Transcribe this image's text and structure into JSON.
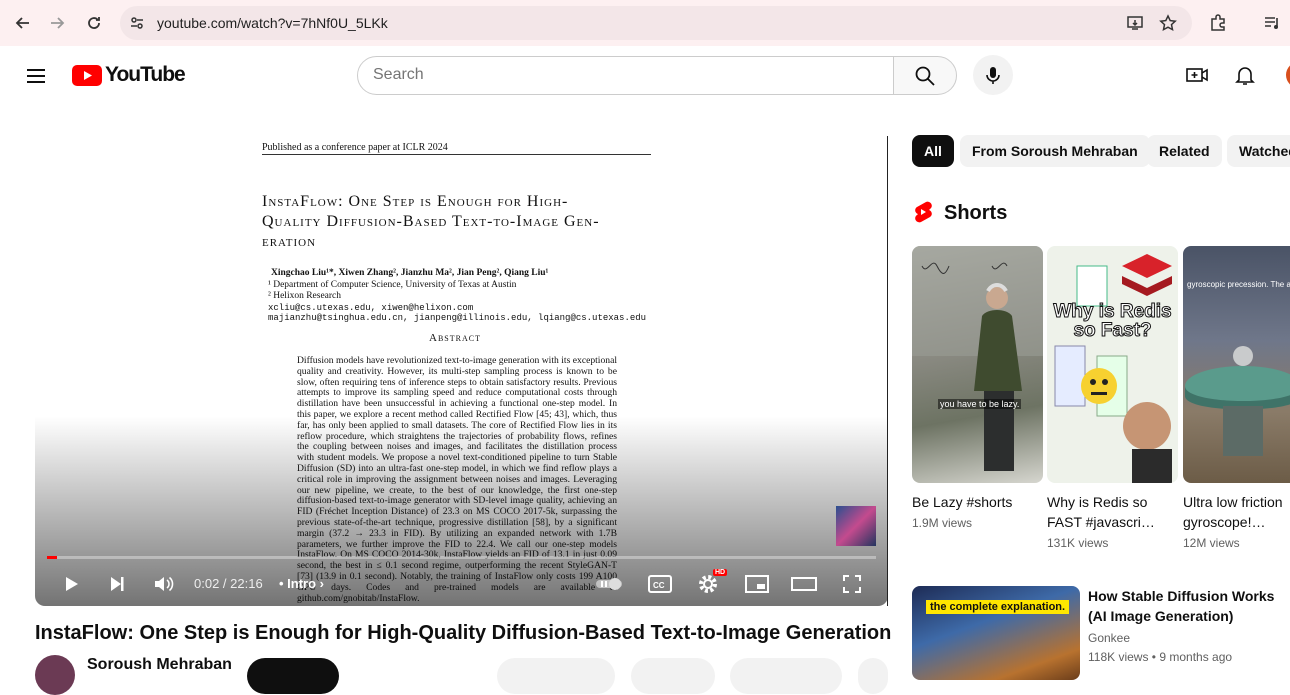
{
  "browser": {
    "url": "youtube.com/watch?v=7hNf0U_5LKk"
  },
  "header": {
    "logo_text": "YouTube",
    "search_placeholder": "Search"
  },
  "paper": {
    "header": "Published as a conference paper at ICLR 2024",
    "title_line1": "InstaFlow:  One Step is Enough for High-",
    "title_line2": "Quality Diffusion-Based Text-to-Image Gen-",
    "title_line3": "eration",
    "authors": "Xingchao Liu¹*, Xiwen Zhang², Jianzhu Ma², Jian Peng², Qiang Liu¹",
    "affil1": "¹ Department of Computer Science, University of Texas at Austin",
    "affil2": "² Helixon Research",
    "email1": "xcliu@cs.utexas.edu, xiwen@helixon.com",
    "email2": "majianzhu@tsinghua.edu.cn, jianpeng@illinois.edu, lqiang@cs.utexas.edu",
    "abstract_heading": "Abstract",
    "abstract": "Diffusion models have revolutionized text-to-image generation with its exceptional quality and creativity. However, its multi-step sampling process is known to be slow, often requiring tens of inference steps to obtain satisfactory results. Previous attempts to improve its sampling speed and reduce computational costs through distillation have been unsuccessful in achieving a functional one-step model. In this paper, we explore a recent method called Rectified Flow [45; 43], which, thus far, has only been applied to small datasets. The core of Rectified Flow lies in its reflow procedure, which straightens the trajectories of probability flows, refines the coupling between noises and images, and facilitates the distillation process with student models. We propose a novel text-conditioned pipeline to turn Stable Diffusion (SD) into an ultra-fast one-step model, in which we find reflow plays a critical role in improving the assignment between noises and images. Leveraging our new pipeline, we create, to the best of our knowledge, the first one-step diffusion-based text-to-image generator with SD-level image quality, achieving an FID (Fréchet Inception Distance) of 23.3 on MS COCO 2017-5k, surpassing the previous state-of-the-art technique, progressive distillation [58], by a significant margin (37.2 → 23.3 in FID). By utilizing an expanded network with 1.7B parameters, we further improve the FID to 22.4. We call our one-step models InstaFlow. On MS COCO 2014-30k, InstaFlow yields an FID of 13.1 in just 0.09 second, the best in ≤ 0.1 second regime, outperforming the recent StyleGAN-T [73] (13.9 in 0.1 second). Notably, the training of InstaFlow only costs 199 A100 GPU days. Codes and pre-trained models are available at github.com/gnobitab/InstaFlow."
  },
  "player": {
    "time": "0:02 / 22:16",
    "chapter": "• Intro ›",
    "progress": 0.012,
    "hd_badge": "HD"
  },
  "video": {
    "title": "InstaFlow: One Step is Enough for High-Quality Diffusion-Based Text-to-Image Generation",
    "channel": "Soroush Mehraban"
  },
  "chips": [
    {
      "label": "All"
    },
    {
      "label": "From Soroush Mehraban"
    },
    {
      "label": "Related"
    },
    {
      "label": "Watched"
    }
  ],
  "shorts": {
    "heading": "Shorts",
    "items": [
      {
        "title": "Be Lazy #shorts",
        "views": "1.9M views",
        "caption": "you have to be lazy."
      },
      {
        "title": "Why is Redis so FAST #javascri…",
        "views": "131K views",
        "overlay": "Why is Redis so Fast?"
      },
      {
        "title": "Ultra low friction gyroscope!…",
        "views": "12M views",
        "caption": "gyroscopic precession. The angular"
      }
    ]
  },
  "related": [
    {
      "title": "How Stable Diffusion Works (AI Image Generation)",
      "channel": "Gonkee",
      "meta": "118K views  •  9 months ago",
      "banner": "the complete explanation."
    }
  ]
}
